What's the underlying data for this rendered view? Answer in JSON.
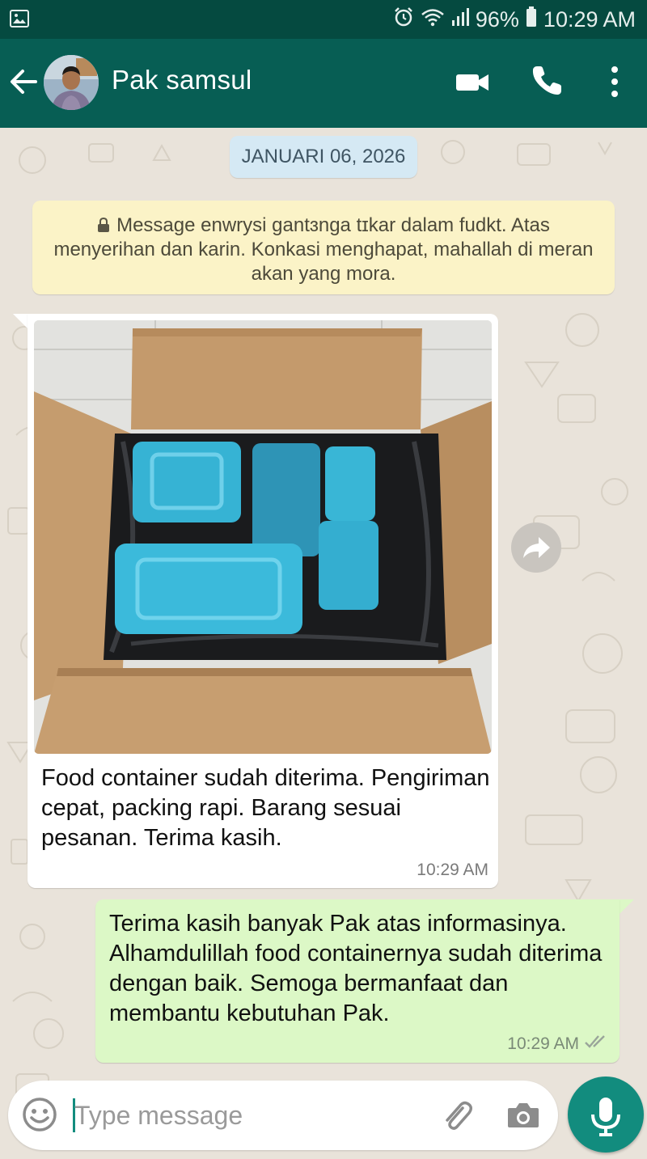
{
  "status_bar": {
    "battery": "96%",
    "time": "10:29 AM",
    "icons": [
      "gallery-icon",
      "alarm-icon",
      "wifi-icon",
      "signal-icon",
      "battery-icon"
    ]
  },
  "header": {
    "contact_name": "Pak samsul",
    "icons": [
      "back-arrow-icon",
      "video-call-icon",
      "phone-icon",
      "more-vert-icon"
    ],
    "color": "#075e54"
  },
  "chat": {
    "date_chip": "JANUARI 06, 2026",
    "encryption_notice": "Message enwrysi gantɜnga tɪkar dalam fudkt. Atas menyerihan dan karin. Konkasi menghapat, mahallah di meran akan yang mora.",
    "incoming": {
      "image_alt": "cardboard box of blue food containers",
      "text": "Food container sudah diterima. Pengiriman cepat, packing rapi. Barang sesuai pesanan. Terima kasih.",
      "time": "10:29 AM"
    },
    "outgoing": {
      "text": "Terima kasih banyak Pak atas informasinya. Alhamdulillah food containernya sudah diterima dengan baik. Semoga bermanfaat dan membantu kebutuhan Pak.",
      "time": "10:29 AM",
      "status": "read"
    }
  },
  "composer": {
    "placeholder": "Type message",
    "value": "",
    "icons": [
      "emoji-icon",
      "attach-icon",
      "camera-icon",
      "mic-icon"
    ],
    "send_color": "#128c7e"
  },
  "colors": {
    "wallpaper": "#e9e3da",
    "outgoing_bubble": "#dcf8c6",
    "notice_bg": "#fbf3c7",
    "date_chip_bg": "#d5e9f4"
  }
}
